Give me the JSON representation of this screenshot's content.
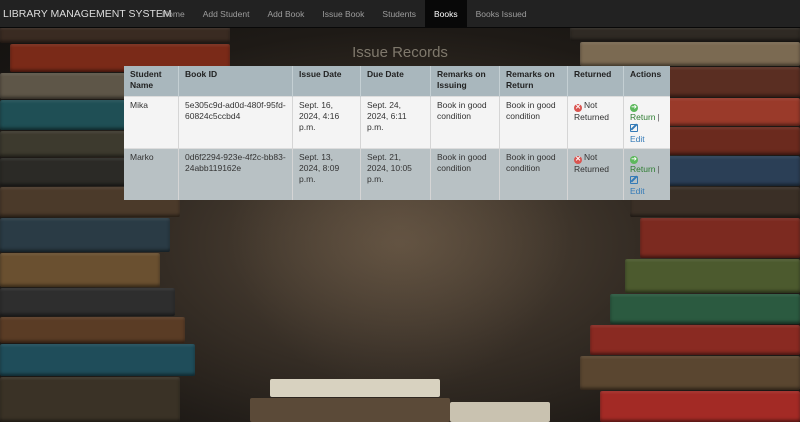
{
  "app": {
    "brand": "LIBRARY MANAGEMENT SYSTEM"
  },
  "nav": {
    "items": [
      {
        "label": "Home",
        "active": false
      },
      {
        "label": "Add Student",
        "active": false
      },
      {
        "label": "Add Book",
        "active": false
      },
      {
        "label": "Issue Book",
        "active": false
      },
      {
        "label": "Students",
        "active": false
      },
      {
        "label": "Books",
        "active": true
      },
      {
        "label": "Books Issued",
        "active": false
      }
    ]
  },
  "page": {
    "title": "Issue Records"
  },
  "table": {
    "headers": [
      "Student Name",
      "Book ID",
      "Issue Date",
      "Due Date",
      "Remarks on Issuing",
      "Remarks on Return",
      "Returned",
      "Actions"
    ],
    "rows": [
      {
        "student": "Mika",
        "book_id": "5e305c9d-ad0d-480f-95fd-60824c5ccbd4",
        "issue_date": "Sept. 16, 2024, 4:16 p.m.",
        "due_date": "Sept. 24, 2024, 6:11 p.m.",
        "remarks_issuing": "Book in good condition",
        "remarks_return": "Book in good condition",
        "returned": "Not Returned",
        "return_label": "Return",
        "edit_label": "Edit"
      },
      {
        "student": "Marko",
        "book_id": "0d6f2294-923e-4f2c-bb83-24abb119162e",
        "issue_date": "Sept. 13, 2024, 8:09 p.m.",
        "due_date": "Sept. 21, 2024, 10:05 p.m.",
        "remarks_issuing": "Book in good condition",
        "remarks_return": "Book in good condition",
        "returned": "Not Returned",
        "return_label": "Return",
        "edit_label": "Edit"
      }
    ]
  },
  "colors": {
    "navbar": "#222222",
    "nav_active": "#080808",
    "header_row": "#a9b7bd",
    "not_returned_icon": "#d9534f",
    "return_icon": "#5cb85c",
    "link": "#337ab7"
  },
  "icons": {
    "not_returned": "x-circle-icon",
    "return": "arrow-circle-right-icon",
    "edit": "edit-icon"
  }
}
